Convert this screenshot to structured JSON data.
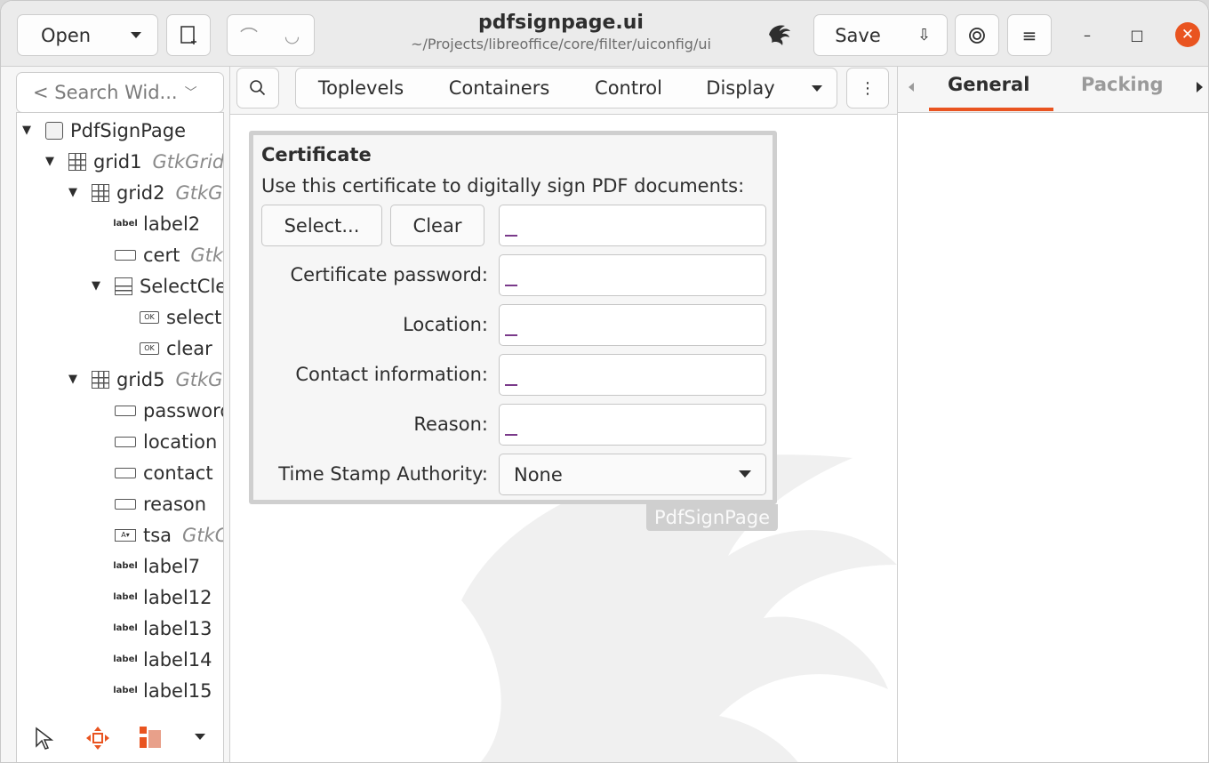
{
  "header": {
    "open_label": "Open",
    "title": "pdfsignpage.ui",
    "subtitle": "~/Projects/libreoffice/core/filter/uiconfig/ui",
    "save_label": "Save"
  },
  "left_panel": {
    "search_placeholder": "< Search Wid...",
    "tree": [
      {
        "label": "PdfSignPage",
        "type": "",
        "icon": "window-icon",
        "level": 0,
        "expanded": true
      },
      {
        "label": "grid1",
        "type": "GtkGrid",
        "icon": "grid-icon",
        "level": 1,
        "expanded": true
      },
      {
        "label": "grid2",
        "type": "GtkGrid",
        "icon": "grid-icon",
        "level": 2,
        "expanded": true
      },
      {
        "label": "label2",
        "type": "GtkLabel",
        "icon": "label-icon",
        "level": 3
      },
      {
        "label": "cert",
        "type": "GtkEntry",
        "icon": "entry-icon",
        "level": 3
      },
      {
        "label": "SelectClear",
        "type": "",
        "icon": "box-icon",
        "level": 3,
        "expanded": true
      },
      {
        "label": "select",
        "type": "",
        "icon": "button-icon",
        "level": 4
      },
      {
        "label": "clear",
        "type": "",
        "icon": "button-icon",
        "level": 4
      },
      {
        "label": "grid5",
        "type": "GtkGrid",
        "icon": "grid-icon",
        "level": 2,
        "expanded": true
      },
      {
        "label": "password",
        "type": "",
        "icon": "entry-icon",
        "level": 3
      },
      {
        "label": "location",
        "type": "",
        "icon": "entry-icon",
        "level": 3
      },
      {
        "label": "contact",
        "type": "",
        "icon": "entry-icon",
        "level": 3
      },
      {
        "label": "reason",
        "type": "",
        "icon": "entry-icon",
        "level": 3
      },
      {
        "label": "tsa",
        "type": "GtkComboBoxText",
        "icon": "combo-icon",
        "level": 3
      },
      {
        "label": "label7",
        "type": "",
        "icon": "label-icon",
        "level": 3
      },
      {
        "label": "label12",
        "type": "",
        "icon": "label-icon",
        "level": 3
      },
      {
        "label": "label13",
        "type": "",
        "icon": "label-icon",
        "level": 3
      },
      {
        "label": "label14",
        "type": "",
        "icon": "label-icon",
        "level": 3
      },
      {
        "label": "label15",
        "type": "",
        "icon": "label-icon",
        "level": 3
      }
    ]
  },
  "palette": {
    "tabs": [
      "Toplevels",
      "Containers",
      "Control",
      "Display"
    ]
  },
  "dialog": {
    "title": "Certificate",
    "description": "Use this certificate to digitally sign PDF documents:",
    "select_label": "Select...",
    "clear_label": "Clear",
    "password_label": "Certificate password:",
    "location_label": "Location:",
    "contact_label": "Contact information:",
    "reason_label": "Reason:",
    "tsa_label": "Time Stamp Authority:",
    "tsa_value": "None",
    "widget_name": "PdfSignPage"
  },
  "right_panel": {
    "tabs": [
      "General",
      "Packing"
    ],
    "active_tab": "General"
  },
  "colors": {
    "accent": "#e95420"
  }
}
